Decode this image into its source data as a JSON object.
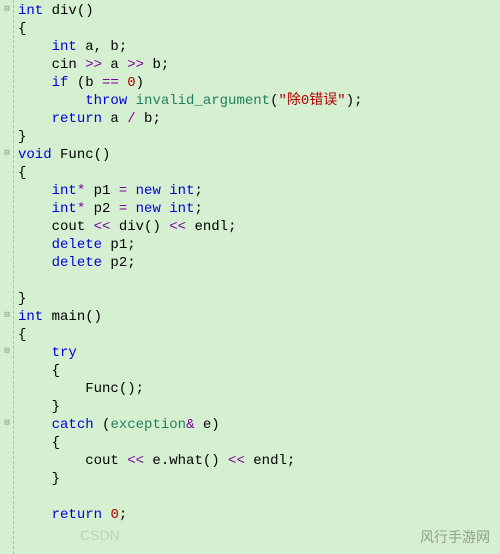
{
  "gutter": [
    "⊟",
    "",
    "",
    "",
    "",
    "",
    "",
    "",
    "⊟",
    "",
    "",
    "",
    "",
    "",
    "",
    "",
    "",
    "⊟",
    "",
    "⊟",
    "",
    "",
    "",
    "⊟",
    "",
    "",
    "",
    "",
    "",
    ""
  ],
  "code": {
    "l0_kw": "int",
    "l0_fn": " div",
    "l0_tail": "()",
    "l1": "{",
    "l2_pre": "    ",
    "l2_kw": "int",
    "l2_tail": " a, b;",
    "l3_pre": "    cin ",
    "l3_op": ">>",
    "l3_mid": " a ",
    "l3_op2": ">>",
    "l3_tail": " b;",
    "l4_pre": "    ",
    "l4_kw": "if",
    "l4_mid": " (b ",
    "l4_op": "==",
    "l4_sp": " ",
    "l4_num": "0",
    "l4_tail": ")",
    "l5_pre": "        ",
    "l5_kw": "throw",
    "l5_sp": " ",
    "l5_fn": "invalid_argument",
    "l5_p1": "(",
    "l5_str": "\"除0错误\"",
    "l5_p2": ");",
    "l6_pre": "    ",
    "l6_kw": "return",
    "l6_mid": " a ",
    "l6_op": "/",
    "l6_tail": " b;",
    "l7": "}",
    "l8_kw": "void",
    "l8_fn": " Func",
    "l8_tail": "()",
    "l9": "{",
    "l10_pre": "    ",
    "l10_kw": "int",
    "l10_op": "*",
    "l10_mid": " p1 ",
    "l10_eq": "=",
    "l10_sp": " ",
    "l10_new": "new",
    "l10_sp2": " ",
    "l10_kw2": "int",
    "l10_tail": ";",
    "l11_pre": "    ",
    "l11_kw": "int",
    "l11_op": "*",
    "l11_mid": " p2 ",
    "l11_eq": "=",
    "l11_sp": " ",
    "l11_new": "new",
    "l11_sp2": " ",
    "l11_kw2": "int",
    "l11_tail": ";",
    "l12_pre": "    cout ",
    "l12_op": "<<",
    "l12_mid": " div() ",
    "l12_op2": "<<",
    "l12_tail": " endl;",
    "l13_pre": "    ",
    "l13_kw": "delete",
    "l13_tail": " p1;",
    "l14_pre": "    ",
    "l14_kw": "delete",
    "l14_tail": " p2;",
    "l15": "",
    "l16": "}",
    "l17_kw": "int",
    "l17_fn": " main",
    "l17_tail": "()",
    "l18": "{",
    "l19_pre": "    ",
    "l19_kw": "try",
    "l20": "    {",
    "l21": "        Func();",
    "l22": "    }",
    "l23_pre": "    ",
    "l23_kw": "catch",
    "l23_p1": " (",
    "l23_type": "exception",
    "l23_amp": "&",
    "l23_tail": " e)",
    "l24": "    {",
    "l25_pre": "        cout ",
    "l25_op": "<<",
    "l25_mid": " e.what() ",
    "l25_op2": "<<",
    "l25_tail": " endl;",
    "l26": "    }",
    "l27": "",
    "l28_pre": "    ",
    "l28_kw": "return",
    "l28_sp": " ",
    "l28_num": "0",
    "l28_tail": ";"
  },
  "watermark1": "CSDN",
  "watermark2": "风行手游网"
}
